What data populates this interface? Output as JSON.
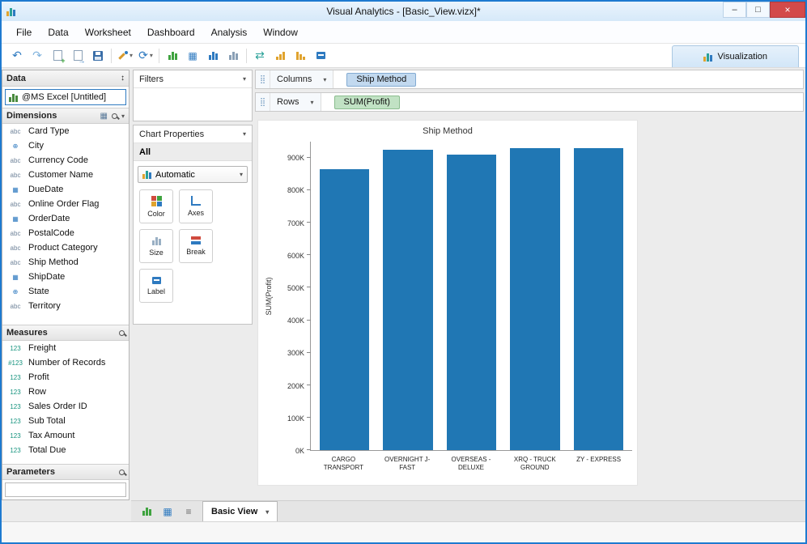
{
  "window": {
    "title": "Visual Analytics - [Basic_View.vizx]*"
  },
  "menu": {
    "items": [
      "File",
      "Data",
      "Worksheet",
      "Dashboard",
      "Analysis",
      "Window"
    ]
  },
  "toolbar": {
    "visualization_tab": "Visualization"
  },
  "data_panel": {
    "title": "Data",
    "source": "@MS Excel [Untitled]",
    "dimensions": {
      "title": "Dimensions",
      "items": [
        {
          "icon": "string-icon",
          "label": "Card Type"
        },
        {
          "icon": "geo-icon",
          "label": "City"
        },
        {
          "icon": "string-icon",
          "label": "Currency Code"
        },
        {
          "icon": "string-icon",
          "label": "Customer Name"
        },
        {
          "icon": "date-icon",
          "label": "DueDate"
        },
        {
          "icon": "string-icon",
          "label": "Online Order Flag"
        },
        {
          "icon": "date-icon",
          "label": "OrderDate"
        },
        {
          "icon": "string-icon",
          "label": "PostalCode"
        },
        {
          "icon": "string-icon",
          "label": "Product Category"
        },
        {
          "icon": "string-icon",
          "label": "Ship Method"
        },
        {
          "icon": "date-icon",
          "label": "ShipDate"
        },
        {
          "icon": "geo-icon",
          "label": "State"
        },
        {
          "icon": "string-icon",
          "label": "Territory"
        }
      ]
    },
    "measures": {
      "title": "Measures",
      "items": [
        {
          "icon": "number-icon",
          "label": "Freight"
        },
        {
          "icon": "count-icon",
          "label": "Number of Records"
        },
        {
          "icon": "number-icon",
          "label": "Profit"
        },
        {
          "icon": "number-icon",
          "label": "Row"
        },
        {
          "icon": "number-icon",
          "label": "Sales Order ID"
        },
        {
          "icon": "number-icon",
          "label": "Sub Total"
        },
        {
          "icon": "number-icon",
          "label": "Tax Amount"
        },
        {
          "icon": "number-icon",
          "label": "Total Due"
        }
      ]
    },
    "parameters": {
      "title": "Parameters"
    }
  },
  "filters_panel": {
    "title": "Filters"
  },
  "chart_properties": {
    "title": "Chart Properties",
    "scope": "All",
    "selected_type": "Automatic",
    "buttons": [
      "Color",
      "Axes",
      "Size",
      "Break",
      "Label"
    ]
  },
  "shelves": {
    "columns_label": "Columns",
    "columns_pill": "Ship Method",
    "rows_label": "Rows",
    "rows_pill": "SUM(Profit)"
  },
  "sheet_bar": {
    "active_tab": "Basic View"
  },
  "chart_data": {
    "type": "bar",
    "title": "Ship Method",
    "ylabel": "SUM(Profit)",
    "categories": [
      "CARGO TRANSPORT",
      "OVERNIGHT J-FAST",
      "OVERSEAS - DELUXE",
      "XRQ - TRUCK GROUND",
      "ZY - EXPRESS"
    ],
    "values": [
      865000,
      925000,
      910000,
      930000,
      930000
    ],
    "ylim": [
      0,
      950000
    ],
    "ytick_values": [
      0,
      100000,
      200000,
      300000,
      400000,
      500000,
      600000,
      700000,
      800000,
      900000
    ],
    "ytick_labels": [
      "0K",
      "100K",
      "200K",
      "300K",
      "400K",
      "500K",
      "600K",
      "700K",
      "800K",
      "900K"
    ],
    "bar_color": "#2077b4",
    "grid": false,
    "legend": false
  }
}
